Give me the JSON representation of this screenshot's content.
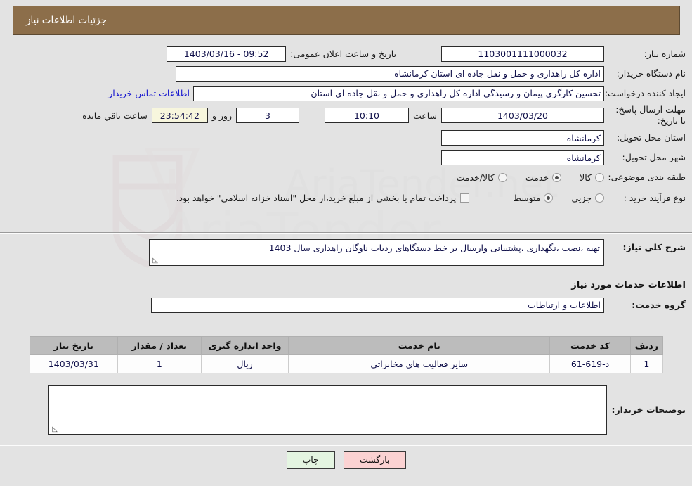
{
  "header": {
    "title": "جزئیات اطلاعات نیاز",
    "bar_color": "#8c6e4a"
  },
  "watermark": {
    "text": "AriaTender.net"
  },
  "info": {
    "need_number_label": "شماره نیاز:",
    "need_number_value": "1103001111000032",
    "public_announce_label": "تاریخ و ساعت اعلان عمومی:",
    "public_announce_value": "1403/03/16 - 09:52",
    "buyer_org_label": "نام دستگاه خریدار:",
    "buyer_org_value": "اداره کل راهداری و حمل و نقل جاده ای استان کرمانشاه",
    "creator_label": "ایجاد کننده درخواست:",
    "creator_value": "تحسین کارگری پیمان و رسیدگی اداره کل راهداری و حمل و نقل جاده ای استان",
    "contact_link": "اطلاعات تماس خریدار",
    "deadline_label": "مهلت ارسال پاسخ: تا تاریخ:",
    "deadline_date": "1403/03/20",
    "hour_label": "ساعت",
    "deadline_time": "10:10",
    "days_remaining": "3",
    "days_label": "روز و",
    "countdown": "23:54:42",
    "countdown_suffix": "ساعت باقي مانده",
    "province_label": "استان محل تحویل:",
    "province_value": "کرمانشاه",
    "city_label": "شهر محل تحویل:",
    "city_value": "کرمانشاه",
    "category_label": "طبقه بندی موضوعی:",
    "category_options": [
      {
        "label": "کالا",
        "selected": false
      },
      {
        "label": "خدمت",
        "selected": true
      },
      {
        "label": "کالا/خدمت",
        "selected": false
      }
    ],
    "process_label": "نوع فرآیند خرید :",
    "process_options": [
      {
        "label": "جزیي",
        "selected": false
      },
      {
        "label": "متوسط",
        "selected": true
      }
    ],
    "treasury_checkbox_label": "پرداخت تمام یا بخشی از مبلغ خرید،از محل \"اسناد خزانه اسلامی\" خواهد بود.",
    "treasury_checked": false
  },
  "description": {
    "label": "شرح كلي نياز:",
    "value": "تهیه ،نصب ،نگهداری ،پشتیبانی وارسال بر خط دستگاهای ردیاب ناوگان راهداری سال 1403"
  },
  "services": {
    "heading": "اطلاعات خدمات مورد نیاز",
    "group_label": "گروه خدمت:",
    "group_value": "اطلاعات و ارتباطات",
    "table": {
      "columns": [
        "ردیف",
        "کد خدمت",
        "نام خدمت",
        "واحد اندازه گیری",
        "تعداد / مقدار",
        "تاریخ نیاز"
      ],
      "rows": [
        {
          "row_no": "1",
          "service_code": "د-619-61",
          "service_name": "سایر فعالیت های مخابراتی",
          "unit": "ریال",
          "quantity": "1",
          "need_date": "1403/03/31"
        }
      ]
    }
  },
  "buyer_notes": {
    "label": "توضیحات خریدار:",
    "value": ""
  },
  "buttons": {
    "print": "چاپ",
    "back": "بازگشت"
  }
}
